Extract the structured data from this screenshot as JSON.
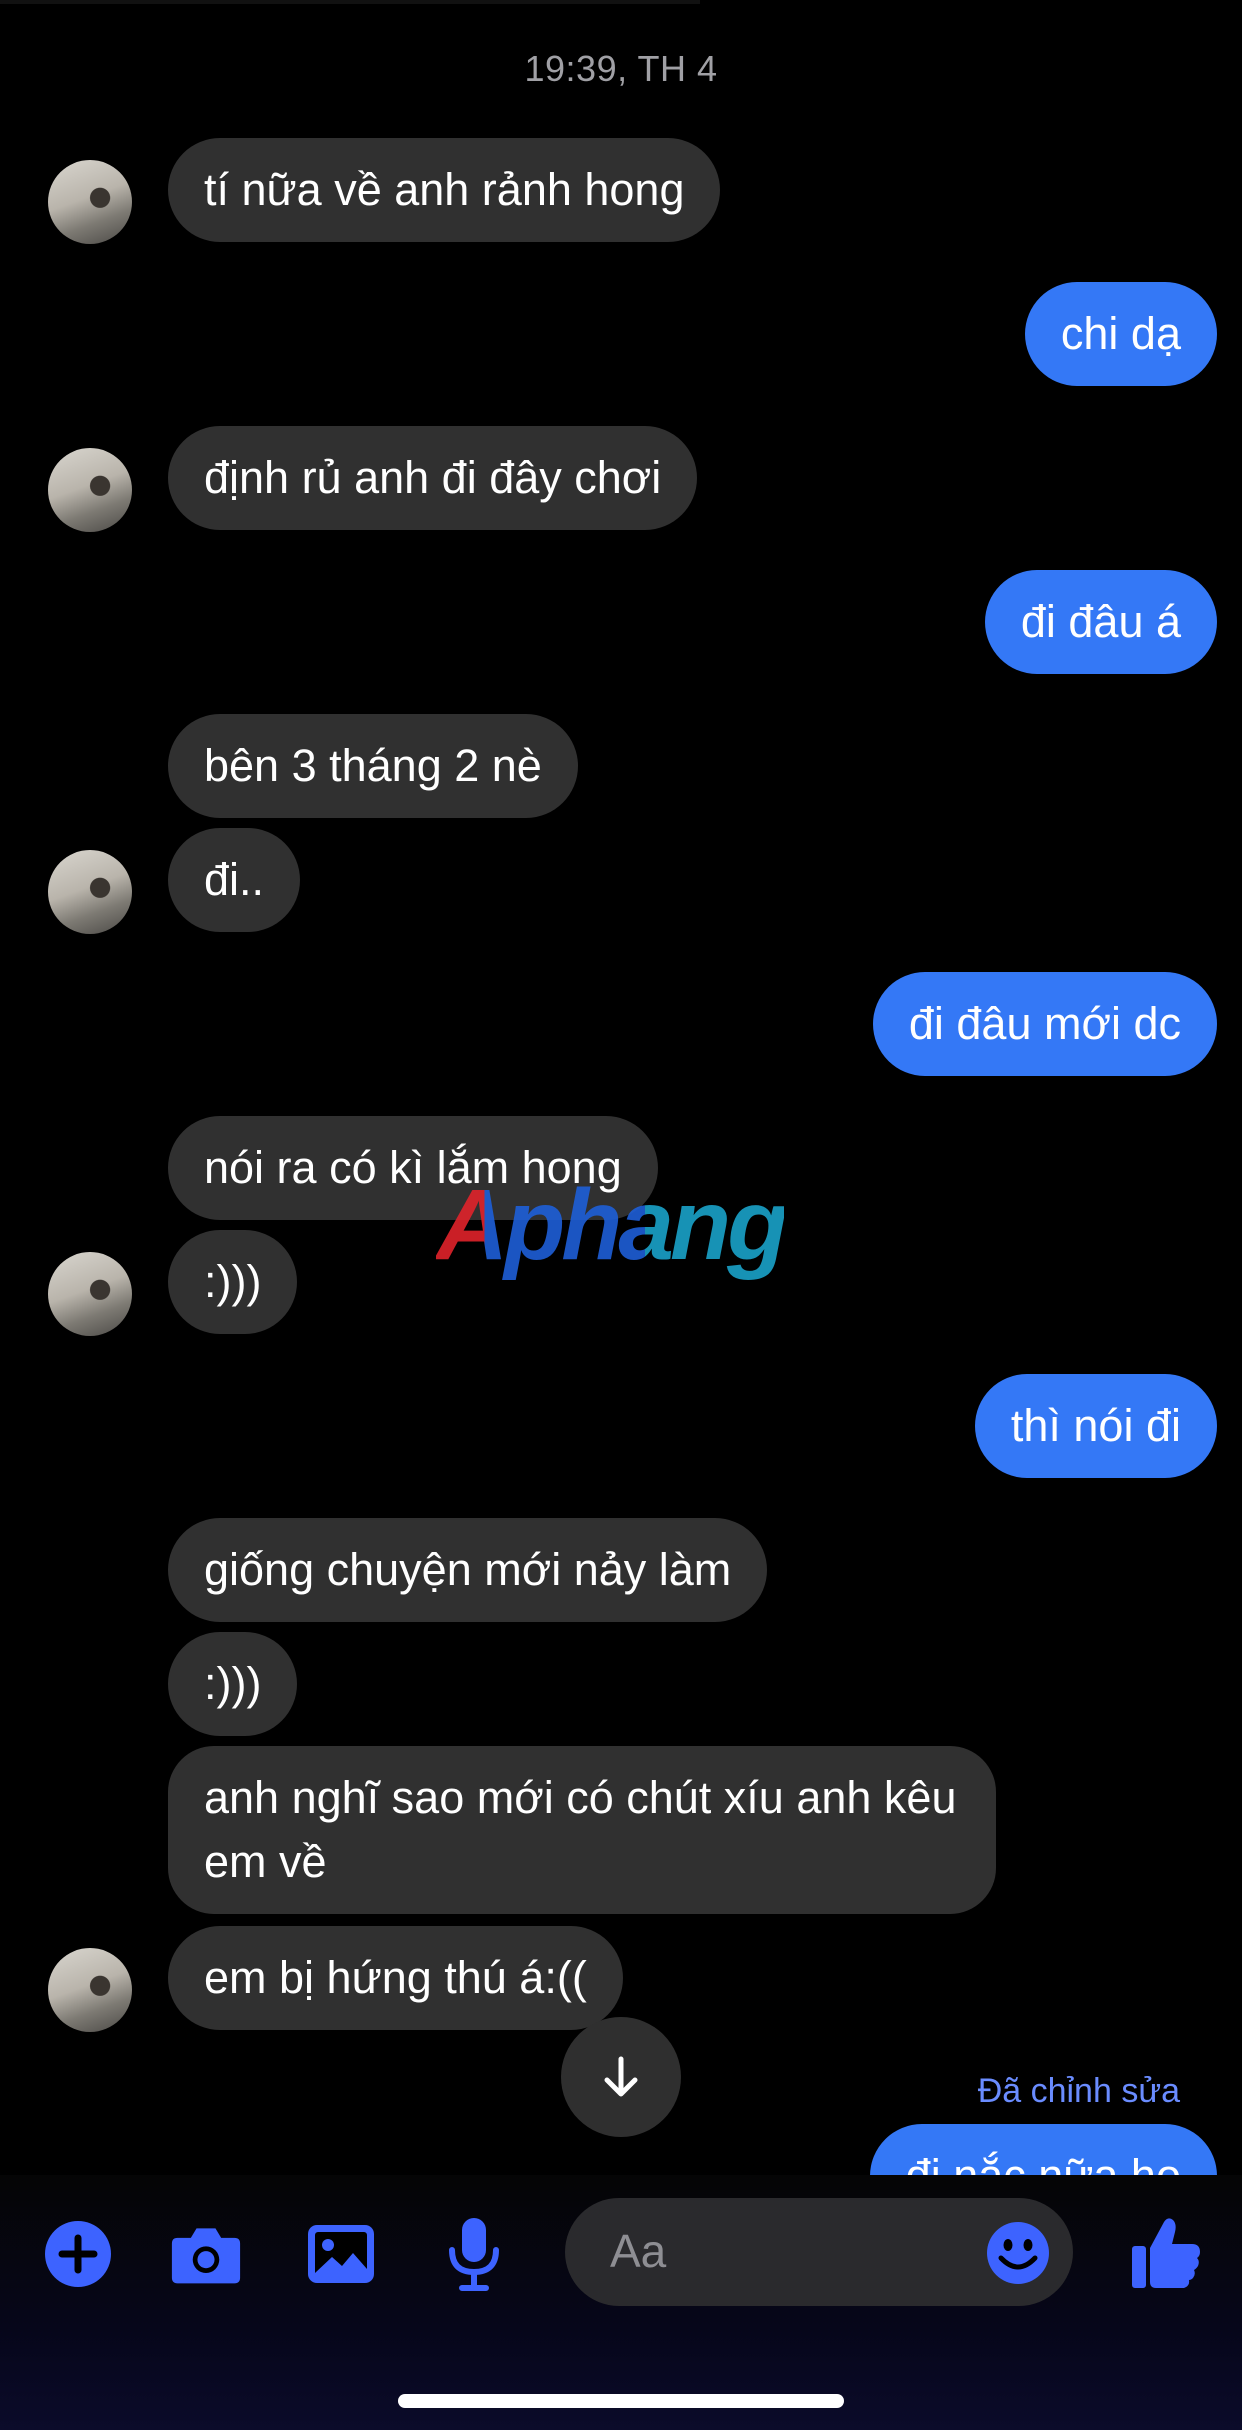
{
  "chat": {
    "timestamp": "19:39, TH 4",
    "messages": [
      {
        "dir": "in",
        "text": "tí nữa về anh rảnh hong"
      },
      {
        "dir": "out",
        "text": "chi dạ"
      },
      {
        "dir": "in",
        "text": "định rủ anh đi đây chơi"
      },
      {
        "dir": "out",
        "text": "đi đâu á"
      },
      {
        "dir": "in",
        "text": "bên 3 tháng 2 nè"
      },
      {
        "dir": "in",
        "text": "đi.."
      },
      {
        "dir": "out",
        "text": "đi đâu mới dc"
      },
      {
        "dir": "in",
        "text": "nói ra có kì lắm hong"
      },
      {
        "dir": "in",
        "text": ":)))"
      },
      {
        "dir": "out",
        "text": "thì nói đi"
      },
      {
        "dir": "in",
        "text": "giống chuyện mới nảy làm"
      },
      {
        "dir": "in",
        "text": ":)))"
      },
      {
        "dir": "in",
        "text": "anh nghĩ sao mới có chút xíu anh kêu em về"
      },
      {
        "dir": "in",
        "text": "em bị hứng thú á:(("
      },
      {
        "dir": "out",
        "text": "đi nắc nữa ho"
      }
    ],
    "edited_label": "Đã chỉnh sửa"
  },
  "watermark": "Aphang",
  "composer": {
    "placeholder": "Aa",
    "icons": [
      "plus-icon",
      "camera-icon",
      "image-icon",
      "microphone-icon",
      "emoji-icon",
      "thumbs-up-icon"
    ]
  },
  "colors": {
    "accent": "#3478f6",
    "incoming_bubble": "#303030",
    "icon_blue": "#3d63ff",
    "background": "#000000"
  }
}
